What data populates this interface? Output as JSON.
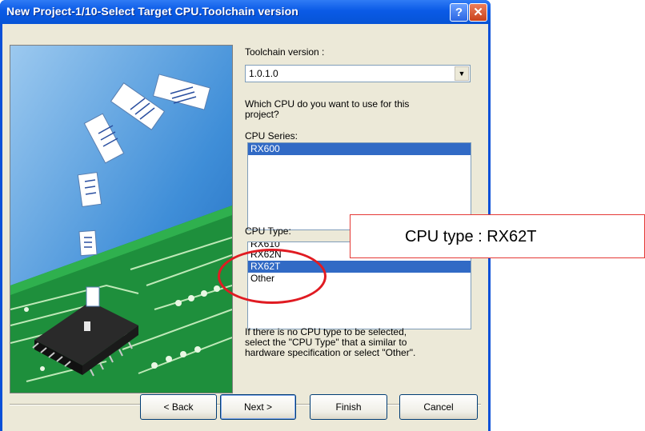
{
  "window": {
    "title": "New Project-1/10-Select Target CPU.Toolchain version",
    "help_label": "?",
    "close_label": "✕"
  },
  "form": {
    "toolchain_label": "Toolchain version :",
    "toolchain_value": "1.0.1.0",
    "question": [
      "Which CPU do you want to use for this",
      "project?"
    ],
    "series_label": "CPU Series:",
    "series_items": [
      "RX600"
    ],
    "series_selected": "RX600",
    "type_label": "CPU Type:",
    "type_items": [
      "RX610",
      "RX62N",
      "RX62T",
      "Other"
    ],
    "type_selected": "RX62T",
    "hint": [
      "If there is no CPU type to be selected,",
      "select the \"CPU Type\" that a similar to",
      "hardware specification or select \"Other\"."
    ]
  },
  "buttons": {
    "back": "< Back",
    "next": "Next >",
    "finish": "Finish",
    "cancel": "Cancel"
  },
  "annotation": {
    "callout_text": "CPU type : RX62T",
    "callout_color": "#e53935"
  },
  "icons": [
    "help-icon",
    "close-icon",
    "dropdown-arrow-icon"
  ]
}
